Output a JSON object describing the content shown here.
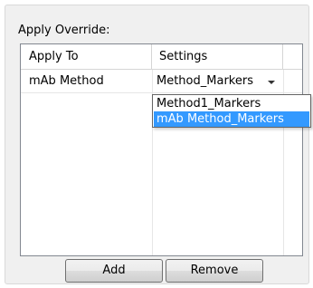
{
  "panel": {
    "title": "Apply Override:"
  },
  "grid": {
    "columns": [
      "Apply To",
      "Settings"
    ],
    "rows": [
      {
        "apply_to": "mAb Method",
        "settings": "Method_Markers"
      }
    ]
  },
  "dropdown": {
    "options": [
      "Method1_Markers",
      "mAb Method_Markers"
    ],
    "highlighted": "mAb Method_Markers"
  },
  "buttons": {
    "add": "Add",
    "remove": "Remove"
  },
  "colors": {
    "highlight": "#3399ff",
    "panel_bg": "#f0f0f0"
  }
}
